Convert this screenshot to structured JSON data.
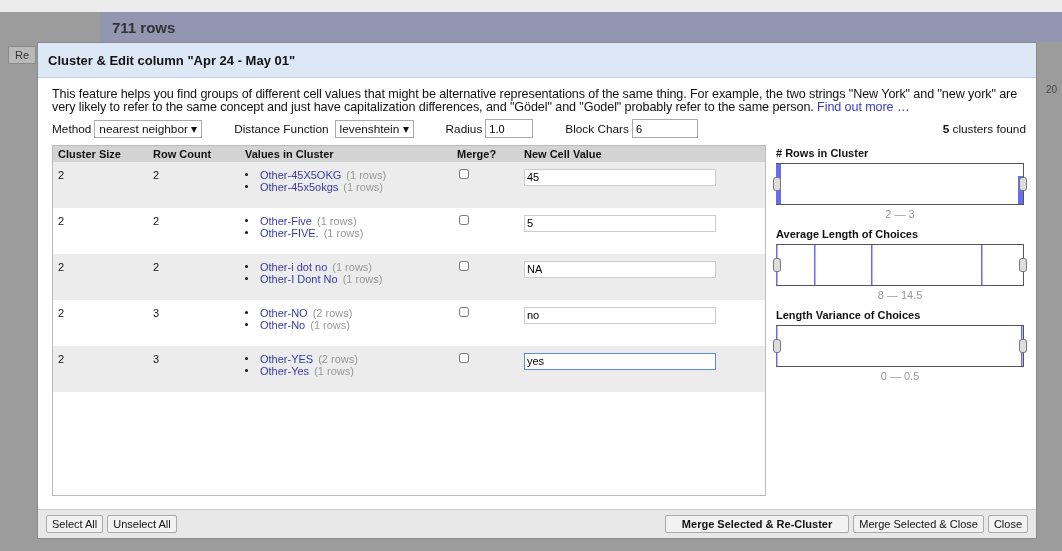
{
  "background": {
    "row_count": "711 rows",
    "button_fragment": "Re",
    "column_fragment": "20"
  },
  "dialog": {
    "title": "Cluster & Edit column \"Apr 24 - May 01\"",
    "description": "This feature helps you find groups of different cell values that might be alternative representations of the same thing. For example, the two strings \"New York\" and \"new york\" are very likely to refer to the same concept and just have capitalization differences, and \"Gödel\" and \"Godel\" probably refer to the same person.",
    "link": "Find out more …",
    "method": {
      "label": "Method",
      "value": "nearest neighbor ▾"
    },
    "distance": {
      "label": "Distance Function",
      "value": "levenshtein ▾"
    },
    "radius": {
      "label": "Radius",
      "value": "1.0"
    },
    "block_chars": {
      "label": "Block Chars",
      "value": "6"
    },
    "clusters_found": "**5** clusters found",
    "columns": [
      "Cluster Size",
      "Row Count",
      "Values in Cluster",
      "Merge?",
      "New Cell Value"
    ],
    "rows": [
      {
        "cluster_size": "2",
        "row_count": "2",
        "values": [
          {
            "value": "Other-45X5OKG",
            "count": "(1 rows)"
          },
          {
            "value": "Other-45x5okgs",
            "count": "(1 rows)"
          }
        ],
        "merge": false,
        "new_value": "45",
        "focused": false
      },
      {
        "cluster_size": "2",
        "row_count": "2",
        "values": [
          {
            "value": "Other-Five",
            "count": "(1 rows)"
          },
          {
            "value": "Other-FIVE.",
            "count": "(1 rows)"
          }
        ],
        "merge": false,
        "new_value": "5",
        "focused": false
      },
      {
        "cluster_size": "2",
        "row_count": "2",
        "values": [
          {
            "value": "Other-i dot no",
            "count": "(1 rows)"
          },
          {
            "value": "Other-I Dont No",
            "count": "(1 rows)"
          }
        ],
        "merge": false,
        "new_value": "NA",
        "focused": false
      },
      {
        "cluster_size": "2",
        "row_count": "3",
        "values": [
          {
            "value": "Other-NO",
            "count": "(2 rows)"
          },
          {
            "value": "Other-No",
            "count": "(1 rows)"
          }
        ],
        "merge": false,
        "new_value": "no",
        "focused": false
      },
      {
        "cluster_size": "2",
        "row_count": "3",
        "values": [
          {
            "value": "Other-YES",
            "count": "(2 rows)"
          },
          {
            "value": "Other-Yes",
            "count": "(1 rows)"
          }
        ],
        "merge": false,
        "new_value": "yes",
        "focused": true
      }
    ],
    "facets": [
      {
        "title": "# Rows in Cluster",
        "range": "2 — 3"
      },
      {
        "title": "Average Length of Choices",
        "range": "8 — 14.5"
      },
      {
        "title": "Length Variance of Choices",
        "range": "0 — 0.5"
      }
    ],
    "left_buttons": [
      {
        "label": "Select All",
        "primary": false
      },
      {
        "label": "Unselect All",
        "primary": false
      }
    ],
    "right_buttons": [
      {
        "label": "Merge Selected & Re-Cluster",
        "primary": true
      },
      {
        "label": "Merge Selected & Close",
        "primary": false
      },
      {
        "label": "Close",
        "primary": false
      }
    ]
  }
}
